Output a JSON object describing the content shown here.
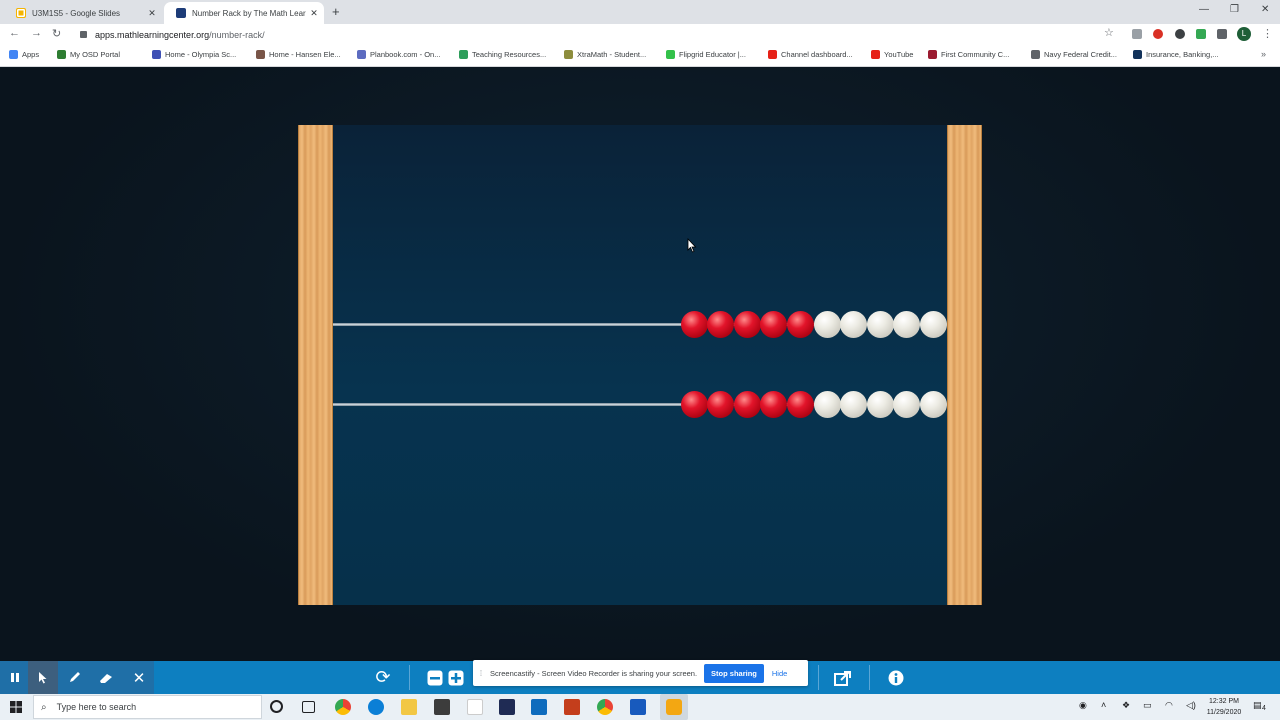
{
  "browser": {
    "tabs": [
      {
        "title": "U3M1S5 - Google Slides",
        "favicon": "slides-icon",
        "active": false
      },
      {
        "title": "Number Rack by The Math Learni",
        "favicon": "mlc-icon",
        "active": true
      }
    ],
    "url_host": "apps.mathlearningcenter.org",
    "url_path": "/number-rack/",
    "profile_initial": "L",
    "bookmarks": [
      {
        "label": "Apps",
        "icon": "apps-grid-icon",
        "color": "#4285f4"
      },
      {
        "label": "My OSD Portal",
        "icon": "tree-icon",
        "color": "#2e7d32"
      },
      {
        "label": "Home - Olympia Sc...",
        "icon": "mountain-icon",
        "color": "#3f51b5"
      },
      {
        "label": "Home - Hansen Ele...",
        "icon": "bird-icon",
        "color": "#795548"
      },
      {
        "label": "Planbook.com - On...",
        "icon": "planbook-icon",
        "color": "#5c6bc0"
      },
      {
        "label": "Teaching Resources...",
        "icon": "tpt-icon",
        "color": "#2e9e5b"
      },
      {
        "label": "XtraMath - Student...",
        "icon": "xtramath-icon",
        "color": "#8d8d3d"
      },
      {
        "label": "Flipgrid Educator |...",
        "icon": "flipgrid-icon",
        "color": "#33c14a"
      },
      {
        "label": "Channel dashboard...",
        "icon": "youtube-icon",
        "color": "#e62117"
      },
      {
        "label": "YouTube",
        "icon": "youtube-icon",
        "color": "#e62117"
      },
      {
        "label": "First Community C...",
        "icon": "star-icon",
        "color": "#9b1b30"
      },
      {
        "label": "Navy Federal Credit...",
        "icon": "globe-icon",
        "color": "#5f6368"
      },
      {
        "label": "Insurance, Banking,...",
        "icon": "usaa-icon",
        "color": "#12325a"
      }
    ]
  },
  "rack": {
    "rows": [
      {
        "red": 5,
        "white": 5
      },
      {
        "red": 5,
        "white": 5
      }
    ],
    "colors": {
      "red": "#e2142a",
      "white": "#ecebe3",
      "board": "#07334f",
      "frame": "#e8ab6a"
    }
  },
  "toolbar": {
    "buttons": [
      "pause-icon",
      "pointer-icon",
      "pen-icon",
      "eraser-icon",
      "close-icon",
      "reset-icon",
      "minus-icon",
      "plus-icon",
      "share-icon",
      "info-icon"
    ]
  },
  "share_banner": {
    "message": "Screencastify - Screen Video Recorder is sharing your screen.",
    "stop_label": "Stop sharing",
    "hide_label": "Hide"
  },
  "taskbar": {
    "search_placeholder": "Type here to search",
    "time": "12:32 PM",
    "date": "11/29/2020",
    "notification_count": "4"
  }
}
